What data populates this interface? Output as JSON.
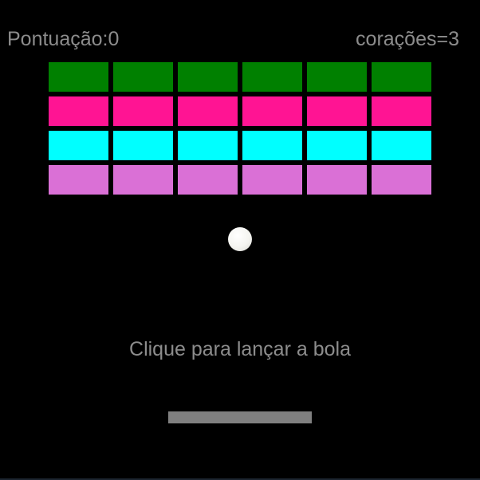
{
  "hud": {
    "score_label": "Pontuação:0",
    "lives_label": "corações=3"
  },
  "prompt": "Clique para lançar a bola",
  "bricks": {
    "columns": 6,
    "rows": [
      {
        "color": "#008000"
      },
      {
        "color": "#ff1493"
      },
      {
        "color": "#00ffff"
      },
      {
        "color": "#da70d6"
      }
    ]
  },
  "colors": {
    "background": "#000000",
    "text": "#8c8c8c",
    "paddle": "#808080",
    "ball": "#f4f4f0"
  }
}
